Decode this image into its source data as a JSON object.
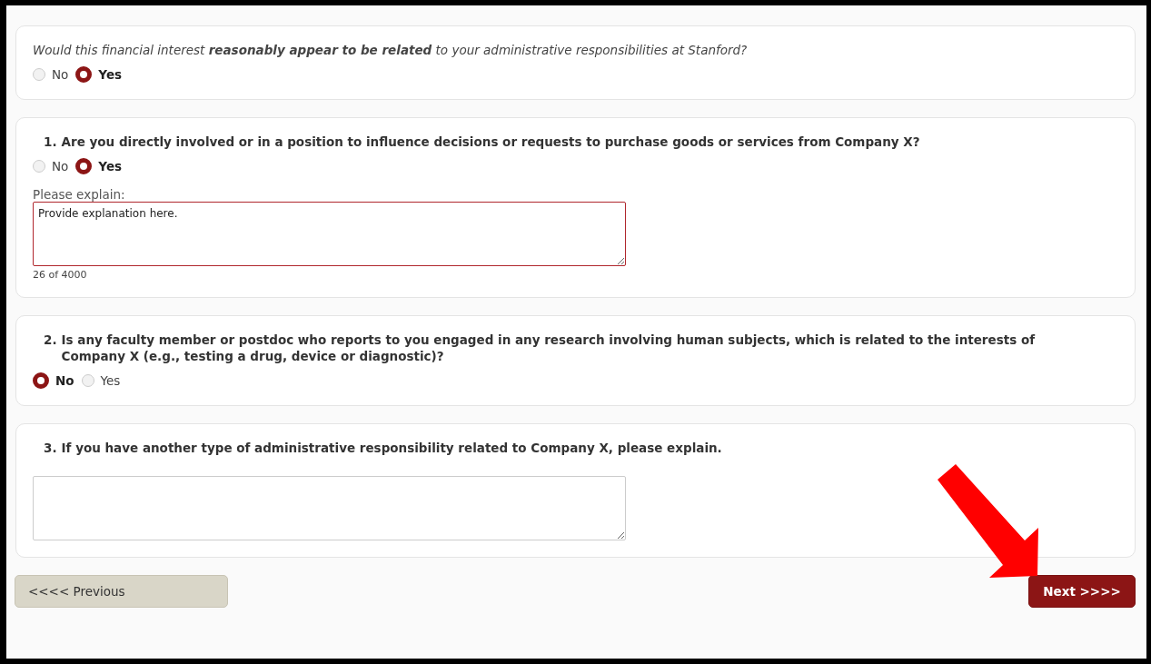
{
  "questions": [
    {
      "kind": "intro",
      "text": "Would this financial interest **reasonably appear to be related** to your administrative responsibilities at Stanford?",
      "options": [
        {
          "label": "No",
          "selected": false
        },
        {
          "label": "Yes",
          "selected": true
        }
      ]
    },
    {
      "kind": "numbered",
      "number": "1.",
      "text": "Are you directly involved or in a position to influence decisions or requests to purchase goods or services from Company X?",
      "options": [
        {
          "label": "No",
          "selected": false
        },
        {
          "label": "Yes",
          "selected": true
        }
      ],
      "explain": {
        "label": "Please explain:",
        "value": "Provide explanation here.",
        "counter": "26 of 4000",
        "invalid": true
      }
    },
    {
      "kind": "numbered",
      "number": "2.",
      "text": "Is any faculty member or postdoc who reports to you engaged in any research involving human subjects, which is related to the interests of Company X (e.g., testing a drug, device or diagnostic)?",
      "options": [
        {
          "label": "No",
          "selected": true
        },
        {
          "label": "Yes",
          "selected": false
        }
      ]
    },
    {
      "kind": "numbered",
      "number": "3.",
      "text": "If you have another type of administrative responsibility related to Company X, please explain.",
      "answer_field": {
        "invalid": false
      }
    }
  ],
  "buttons": {
    "previous": "<<<< Previous",
    "next": "Next >>>>"
  }
}
